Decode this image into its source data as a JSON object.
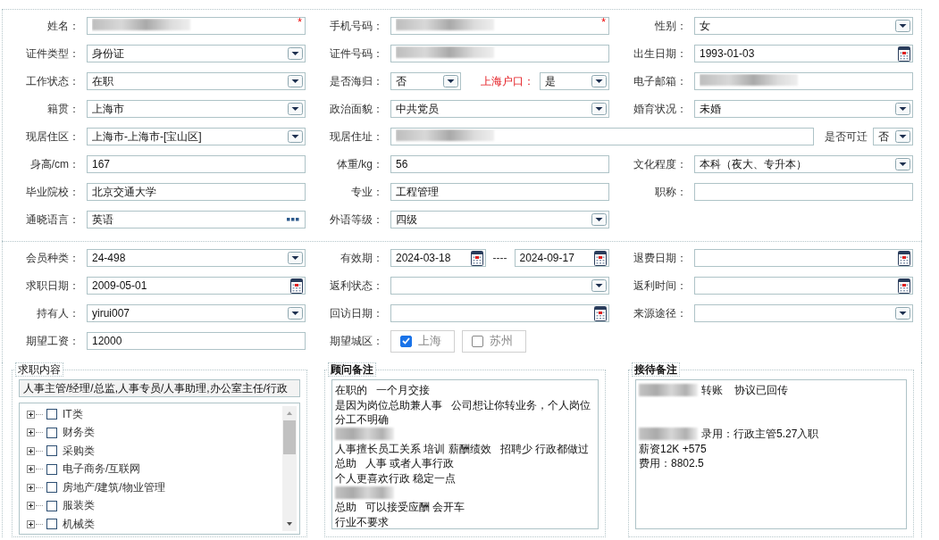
{
  "sections": [
    {
      "rows": [
        [
          {
            "label": "姓名：",
            "controls": [
              {
                "kind": "text",
                "redacted": true,
                "required_mark": "*"
              }
            ]
          },
          {
            "label": "手机号码：",
            "controls": [
              {
                "kind": "text",
                "redacted": true,
                "required_mark": "*"
              }
            ]
          },
          {
            "label": "性别：",
            "controls": [
              {
                "kind": "select",
                "value": "女"
              }
            ]
          }
        ],
        [
          {
            "label": "证件类型：",
            "controls": [
              {
                "kind": "select",
                "value": "身份证"
              }
            ]
          },
          {
            "label": "证件号码：",
            "controls": [
              {
                "kind": "text",
                "redacted": true
              }
            ]
          },
          {
            "label": "出生日期：",
            "controls": [
              {
                "kind": "date",
                "value": "1993-01-03"
              }
            ]
          }
        ],
        [
          {
            "label": "工作状态：",
            "controls": [
              {
                "kind": "select",
                "value": "在职"
              }
            ]
          },
          {
            "label": "是否海归：",
            "controls": [
              {
                "kind": "select",
                "value": "否"
              },
              {
                "kind": "label",
                "text": "上海户口：",
                "highlight": true
              },
              {
                "kind": "select",
                "value": "是"
              }
            ]
          },
          {
            "label": "电子邮箱：",
            "controls": [
              {
                "kind": "text",
                "redacted": true
              }
            ]
          }
        ],
        [
          {
            "label": "籍贯：",
            "controls": [
              {
                "kind": "select",
                "value": "上海市"
              }
            ]
          },
          {
            "label": "政治面貌：",
            "controls": [
              {
                "kind": "select",
                "value": "中共党员"
              }
            ]
          },
          {
            "label": "婚育状况：",
            "controls": [
              {
                "kind": "select",
                "value": "未婚"
              }
            ]
          }
        ],
        [
          {
            "label": "现居住区：",
            "controls": [
              {
                "kind": "select",
                "value": "上海市-上海市-[宝山区]"
              }
            ]
          },
          {
            "label": "现居住址：",
            "controls": [
              {
                "kind": "text",
                "redacted": true
              },
              {
                "kind": "label",
                "text": "是否可迁",
                "highlight": false
              },
              {
                "kind": "select",
                "value": "否"
              }
            ]
          }
        ],
        [
          {
            "label": "身高/cm：",
            "controls": [
              {
                "kind": "text",
                "value": "167"
              }
            ]
          },
          {
            "label": "体重/kg：",
            "controls": [
              {
                "kind": "text",
                "value": "56"
              }
            ]
          },
          {
            "label": "文化程度：",
            "controls": [
              {
                "kind": "select",
                "value": "本科（夜大、专升本）"
              }
            ]
          }
        ],
        [
          {
            "label": "毕业院校：",
            "controls": [
              {
                "kind": "text",
                "value": "北京交通大学"
              }
            ]
          },
          {
            "label": "专业：",
            "controls": [
              {
                "kind": "text",
                "value": "工程管理"
              }
            ]
          },
          {
            "label": "职称：",
            "controls": [
              {
                "kind": "text"
              }
            ]
          }
        ],
        [
          {
            "label": "通晓语言：",
            "controls": [
              {
                "kind": "lookup",
                "value": "英语"
              }
            ]
          },
          {
            "label": "外语等级：",
            "controls": [
              {
                "kind": "select",
                "value": "四级"
              }
            ]
          }
        ]
      ]
    },
    {
      "rows": [
        [
          {
            "label": "会员种类：",
            "controls": [
              {
                "kind": "select",
                "value": "24-498"
              }
            ]
          },
          {
            "label": "有效期：",
            "controls": [
              {
                "kind": "date",
                "value": "2024-03-18"
              },
              {
                "kind": "separator",
                "text": "----"
              },
              {
                "kind": "date",
                "value": "2024-09-17"
              }
            ]
          },
          {
            "label": "退费日期：",
            "controls": [
              {
                "kind": "date"
              }
            ]
          }
        ],
        [
          {
            "label": "求职日期：",
            "controls": [
              {
                "kind": "date",
                "value": "2009-05-01"
              }
            ]
          },
          {
            "label": "返利状态：",
            "controls": [
              {
                "kind": "select"
              }
            ]
          },
          {
            "label": "返利时间：",
            "controls": [
              {
                "kind": "date"
              }
            ]
          }
        ],
        [
          {
            "label": "持有人：",
            "controls": [
              {
                "kind": "select",
                "value": "yirui007"
              }
            ]
          },
          {
            "label": "回访日期：",
            "controls": [
              {
                "kind": "date"
              }
            ]
          },
          {
            "label": "来源途径：",
            "controls": [
              {
                "kind": "select"
              }
            ]
          }
        ],
        [
          {
            "label": "期望工资：",
            "controls": [
              {
                "kind": "text",
                "value": "12000"
              }
            ]
          },
          {
            "label": "期望城区：",
            "controls": [
              {
                "kind": "option",
                "text": "上海",
                "checked": true
              },
              {
                "kind": "option",
                "text": "苏州",
                "checked": false
              }
            ]
          }
        ]
      ]
    }
  ],
  "panels": [
    {
      "kind": "tree",
      "title": "求职内容",
      "summary": "人事主管/经理/总监,人事专员/人事助理,办公室主任/行政",
      "items": [
        {
          "label": "IT类",
          "checked": false,
          "expanded": false
        },
        {
          "label": "财务类",
          "checked": false,
          "expanded": false
        },
        {
          "label": "采购类",
          "checked": false,
          "expanded": false
        },
        {
          "label": "电子商务/互联网",
          "checked": false,
          "expanded": false
        },
        {
          "label": "房地产/建筑/物业管理",
          "checked": false,
          "expanded": false
        },
        {
          "label": "服装类",
          "checked": false,
          "expanded": false
        },
        {
          "label": "机械类",
          "checked": false,
          "expanded": false
        }
      ]
    },
    {
      "kind": "notes",
      "title": "顾问备注",
      "lines": [
        {
          "kind": "text",
          "segments": [
            {
              "kind": "text",
              "text": "在职的   一个月交接"
            }
          ]
        },
        {
          "kind": "text",
          "segments": [
            {
              "kind": "text",
              "text": "是因为岗位总助兼人事   公司想让你转业务，个人岗位"
            }
          ]
        },
        {
          "kind": "text",
          "segments": [
            {
              "kind": "text",
              "text": "分工不明确"
            }
          ]
        },
        {
          "kind": "text",
          "segments": [
            {
              "kind": "redacted"
            }
          ]
        },
        {
          "kind": "text",
          "segments": [
            {
              "kind": "text",
              "text": "人事擅长员工关系 培训 薪酬绩效   招聘少 行政都做过"
            }
          ]
        },
        {
          "kind": "text",
          "segments": [
            {
              "kind": "text",
              "text": "总助   人事 或者人事行政"
            }
          ]
        },
        {
          "kind": "text",
          "segments": [
            {
              "kind": "text",
              "text": "个人更喜欢行政 稳定一点"
            }
          ]
        },
        {
          "kind": "text",
          "segments": [
            {
              "kind": "redacted"
            }
          ]
        },
        {
          "kind": "text",
          "segments": [
            {
              "kind": "text",
              "text": "总助   可以接受应酬 会开车"
            }
          ]
        },
        {
          "kind": "text",
          "segments": [
            {
              "kind": "text",
              "text": "行业不要求"
            }
          ]
        }
      ]
    },
    {
      "kind": "notes",
      "title": "接待备注",
      "lines": [
        {
          "kind": "text",
          "segments": [
            {
              "kind": "redacted"
            },
            {
              "kind": "text",
              "text": "转账    协议已回传"
            }
          ]
        },
        {
          "kind": "blank"
        },
        {
          "kind": "blank"
        },
        {
          "kind": "text",
          "segments": [
            {
              "kind": "redacted"
            },
            {
              "kind": "text",
              "text": "录用：行政主管5.27入职"
            }
          ]
        },
        {
          "kind": "text",
          "segments": [
            {
              "kind": "text",
              "text": "薪资12K +575"
            }
          ]
        },
        {
          "kind": "text",
          "segments": [
            {
              "kind": "text",
              "text": "费用：8802.5"
            }
          ]
        }
      ]
    }
  ]
}
